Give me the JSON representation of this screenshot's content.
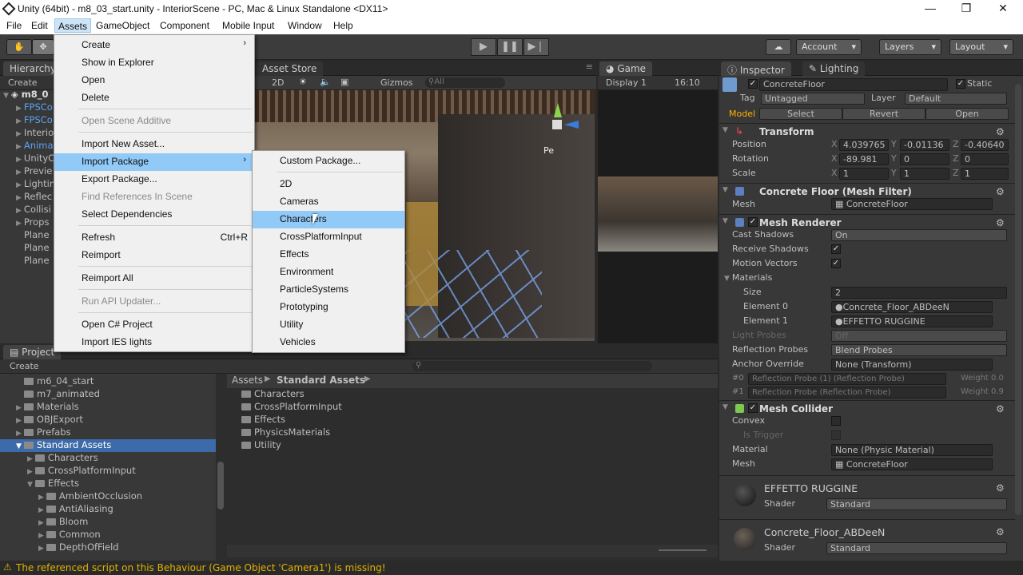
{
  "window": {
    "title": "Unity (64bit) - m8_03_start.unity - InteriorScene - PC, Mac & Linux Standalone <DX11>",
    "minimize": "—",
    "maximize": "❐",
    "close": "✕"
  },
  "menubar": {
    "items": [
      "File",
      "Edit",
      "Assets",
      "GameObject",
      "Component",
      "Mobile Input",
      "Window",
      "Help"
    ]
  },
  "toolbar": {
    "account": "Account",
    "layers": "Layers",
    "layout": "Layout"
  },
  "hierarchy": {
    "tab": "Hierarchy",
    "create": "Create",
    "scene": "m8_0",
    "items": [
      "FPSCo",
      "FPSCo",
      "Interio",
      "Anima",
      "UnityC",
      "Previe",
      "Lightin",
      "Reflec",
      "Collisi",
      "Props",
      "Plane",
      "Plane",
      "Plane"
    ]
  },
  "scene": {
    "asset_store_tab": "Asset Store",
    "mode_2d": "2D",
    "gizmos": "Gizmos",
    "search_placeholder": "All",
    "persp": "Pe"
  },
  "game": {
    "tab": "Game",
    "display": "Display 1",
    "aspect": "16:10"
  },
  "assets_menu": {
    "items": [
      {
        "label": "Create",
        "submenu": true
      },
      {
        "label": "Show in Explorer"
      },
      {
        "label": "Open"
      },
      {
        "label": "Delete"
      },
      {
        "label": "Open Scene Additive",
        "disabled": true
      },
      {
        "label": "Import New Asset..."
      },
      {
        "label": "Import Package",
        "submenu": true,
        "highlighted": true
      },
      {
        "label": "Export Package..."
      },
      {
        "label": "Find References In Scene",
        "disabled": true
      },
      {
        "label": "Select Dependencies"
      },
      {
        "label": "Refresh",
        "shortcut": "Ctrl+R"
      },
      {
        "label": "Reimport"
      },
      {
        "label": "Reimport All"
      },
      {
        "label": "Run API Updater...",
        "disabled": true
      },
      {
        "label": "Open C# Project"
      },
      {
        "label": "Import IES lights"
      }
    ]
  },
  "import_package_menu": {
    "items": [
      "Custom Package...",
      "2D",
      "Cameras",
      "Characters",
      "CrossPlatformInput",
      "Effects",
      "Environment",
      "ParticleSystems",
      "Prototyping",
      "Utility",
      "Vehicles"
    ],
    "highlighted": "Characters"
  },
  "project": {
    "tab": "Project",
    "create": "Create",
    "tree": [
      "m6_04_start",
      "m7_animated",
      "Materials",
      "OBJExport",
      "Prefabs",
      "Standard Assets",
      "Characters",
      "CrossPlatformInput",
      "Effects",
      "AmbientOcclusion",
      "AntiAliasing",
      "Bloom",
      "Common",
      "DepthOfField"
    ],
    "breadcrumb": [
      "Assets",
      "Standard Assets"
    ],
    "folders": [
      "Characters",
      "CrossPlatformInput",
      "Effects",
      "PhysicsMaterials",
      "Utility"
    ]
  },
  "inspector": {
    "tab": "Inspector",
    "lighting_tab": "Lighting",
    "object_name": "ConcreteFloor",
    "static_label": "Static",
    "tag_label": "Tag",
    "tag_value": "Untagged",
    "layer_label": "Layer",
    "layer_value": "Default",
    "model_label": "Model",
    "select": "Select",
    "revert": "Revert",
    "open": "Open",
    "transform": {
      "title": "Transform",
      "position_label": "Position",
      "position": [
        "4.039765",
        "-0.01136",
        "-0.40640"
      ],
      "rotation_label": "Rotation",
      "rotation": [
        "-89.981",
        "0",
        "0"
      ],
      "scale_label": "Scale",
      "scale": [
        "1",
        "1",
        "1"
      ]
    },
    "mesh_filter": {
      "title": "Concrete Floor (Mesh Filter)",
      "mesh_label": "Mesh",
      "mesh": "ConcreteFloor"
    },
    "mesh_renderer": {
      "title": "Mesh Renderer",
      "cast_shadows_label": "Cast Shadows",
      "cast_shadows": "On",
      "receive_shadows_label": "Receive Shadows",
      "motion_vectors_label": "Motion Vectors",
      "materials_label": "Materials",
      "size_label": "Size",
      "size": "2",
      "element0_label": "Element 0",
      "element0": "Concrete_Floor_ABDeeN",
      "element1_label": "Element 1",
      "element1": "EFFETTO RUGGINE",
      "light_probes_label": "Light Probes",
      "light_probes": "Off",
      "reflection_probes_label": "Reflection Probes",
      "reflection_probes": "Blend Probes",
      "anchor_label": "Anchor Override",
      "anchor": "None (Transform)",
      "probe0_idx": "#0",
      "probe0": "Reflection Probe (1) (Reflection Probe)",
      "probe0_weight": "Weight 0.0",
      "probe1_idx": "#1",
      "probe1": "Reflection Probe (Reflection Probe)",
      "probe1_weight": "Weight 0.9"
    },
    "mesh_collider": {
      "title": "Mesh Collider",
      "convex_label": "Convex",
      "trigger_label": "Is Trigger",
      "material_label": "Material",
      "material": "None (Physic Material)",
      "mesh_label": "Mesh",
      "mesh": "ConcreteFloor"
    },
    "materials": [
      {
        "name": "EFFETTO RUGGINE",
        "shader_label": "Shader",
        "shader": "Standard"
      },
      {
        "name": "Concrete_Floor_ABDeeN",
        "shader_label": "Shader",
        "shader": "Standard"
      }
    ]
  },
  "status": {
    "message": "The referenced script on this Behaviour (Game Object 'Camera1') is missing!"
  }
}
